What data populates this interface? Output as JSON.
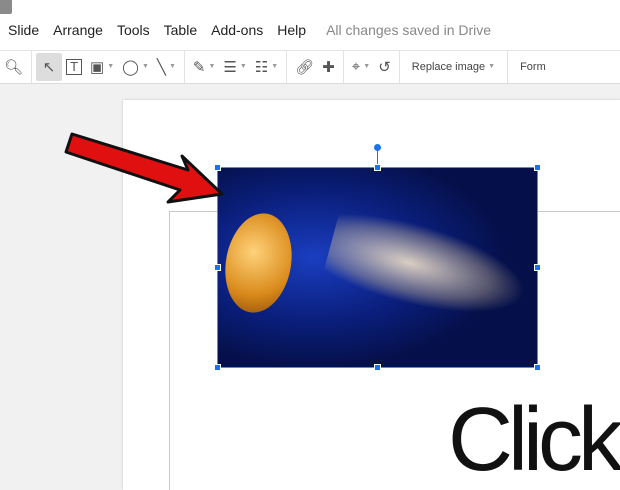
{
  "menu": {
    "items": [
      "Slide",
      "Arrange",
      "Tools",
      "Table",
      "Add-ons",
      "Help"
    ],
    "status": "All changes saved in Drive"
  },
  "toolbar": {
    "replace_image": "Replace image",
    "format": "Form"
  },
  "slide": {
    "title_text": "Click"
  },
  "colors": {
    "accent": "#1a73e8",
    "arrow": "#e01010"
  }
}
